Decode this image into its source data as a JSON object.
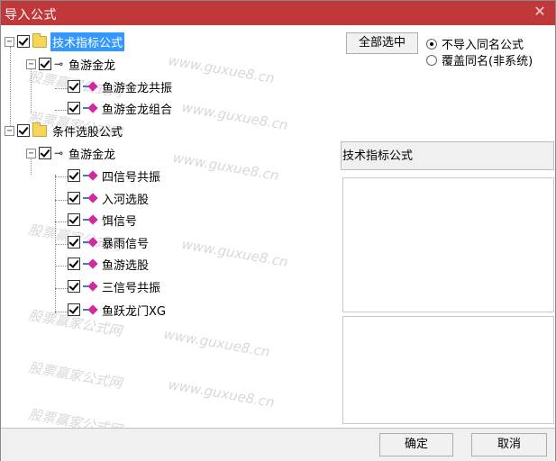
{
  "window": {
    "title": "导入公式",
    "close_icon": "close-icon"
  },
  "tree": {
    "nodes": [
      {
        "label": "技术指标公式",
        "kind": "folder",
        "expander": "−",
        "selected": true
      },
      {
        "label": "鱼游金龙",
        "kind": "key",
        "expander": "−"
      },
      {
        "label": "鱼游金龙共振",
        "kind": "formula"
      },
      {
        "label": "鱼游金龙组合",
        "kind": "formula"
      },
      {
        "label": "条件选股公式",
        "kind": "folder",
        "expander": "−"
      },
      {
        "label": "鱼游金龙",
        "kind": "key",
        "expander": "−"
      },
      {
        "label": "四信号共振",
        "kind": "formula"
      },
      {
        "label": "入河选股",
        "kind": "formula"
      },
      {
        "label": "饵信号",
        "kind": "formula"
      },
      {
        "label": "暴雨信号",
        "kind": "formula"
      },
      {
        "label": "鱼游选股",
        "kind": "formula"
      },
      {
        "label": "三信号共振",
        "kind": "formula"
      },
      {
        "label": "鱼跃龙门XG",
        "kind": "formula"
      }
    ],
    "watermark_cn": "股票赢家公式网",
    "watermark_en": "www.guxue8.cn"
  },
  "options": {
    "select_all_label": "全部选中",
    "radio_no_import": "不导入同名公式",
    "radio_overwrite": "覆盖同名(非系统)",
    "selected_radio": "no_import"
  },
  "details": {
    "category_label": "技术指标公式"
  },
  "footer": {
    "ok_label": "确定",
    "cancel_label": "取消"
  },
  "colors": {
    "titlebar": "#c0383a",
    "selection": "#3399ff",
    "formula_diamond": "#d12aa0"
  }
}
